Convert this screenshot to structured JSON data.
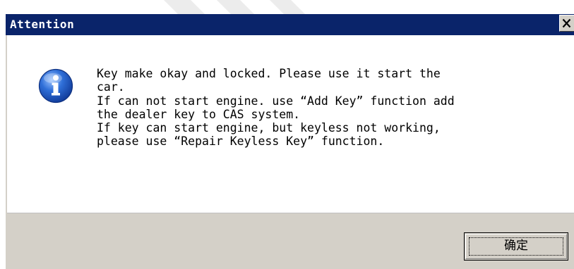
{
  "window": {
    "title": "Attention",
    "close_icon": "close-icon"
  },
  "message": {
    "icon": "info-icon",
    "text": "Key make okay and locked. Please use it start the\ncar.\nIf can not start engine. use “Add Key” function add\nthe dealer key to CAS system.\nIf key can start engine, but keyless not working,\nplease use “Repair Keyless Key” function."
  },
  "footer": {
    "ok_label": "确定"
  },
  "colors": {
    "titlebar": "#0a246a",
    "button_face": "#d4d0c8",
    "icon_blue": "#1a4fb8"
  }
}
